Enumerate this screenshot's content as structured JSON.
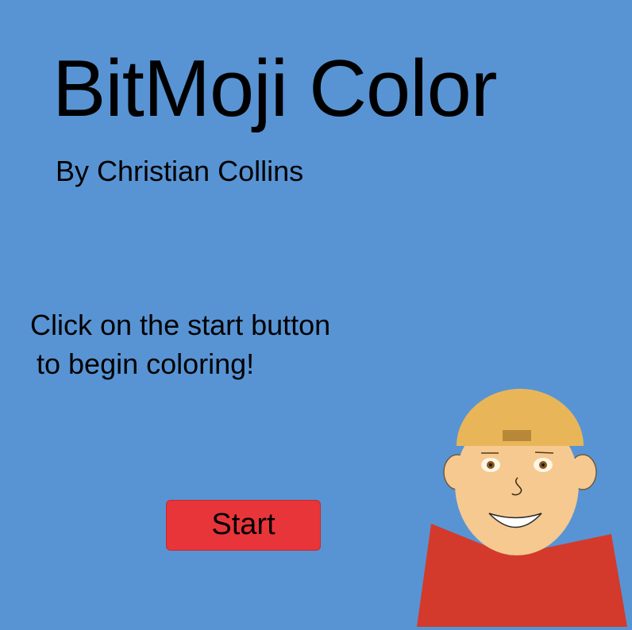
{
  "title": "BitMoji Color",
  "subtitle": "By Christian Collins",
  "instructions": {
    "line1": "Click on the start button",
    "line2": "to begin coloring!"
  },
  "start_button": {
    "label": "Start"
  },
  "avatar": {
    "icon": "bitmoji-character-icon",
    "colors": {
      "background": "#5894d4",
      "skin": "#f5c98f",
      "hat": "#e8b659",
      "hat_strap": "#b8883a",
      "shirt": "#d33a2c",
      "eyes": "#8a5a1a",
      "mouth": "#ffffff"
    }
  }
}
